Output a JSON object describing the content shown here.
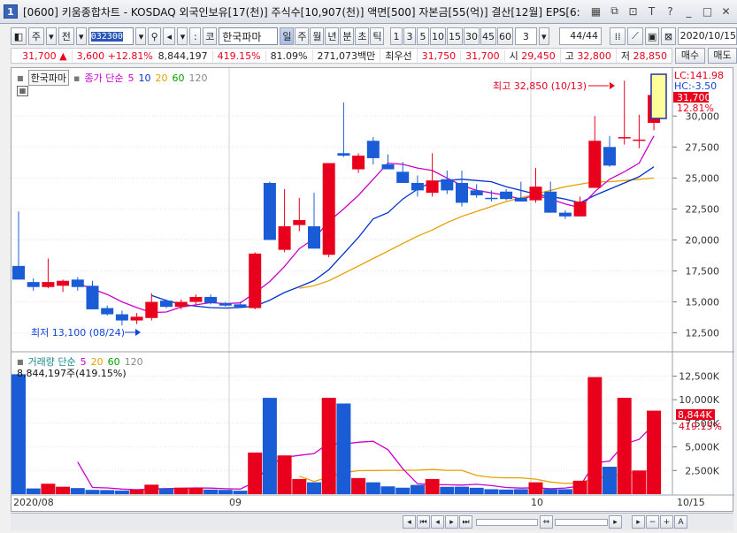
{
  "window": {
    "number": "1",
    "title": "[0600] 키움종합차트 - KOSDAQ 외국인보유[17(천)] 주식수[10,907(천)] 액면[500] 자본금[55(억)] 결산[12월] EPS[6:"
  },
  "toolbar": {
    "period_main": "주",
    "period_all": "전",
    "stock_code": "032300",
    "stock_prefix": "코",
    "stock_name": "한국파마",
    "period_tabs": [
      "일",
      "주",
      "월",
      "년",
      "분",
      "초",
      "틱"
    ],
    "selected_period": "일",
    "interval_buttons": [
      "1",
      "3",
      "5",
      "10",
      "15",
      "30",
      "45",
      "60"
    ],
    "interval_select": "3",
    "page_count": "44/44",
    "date": "2020/10/15"
  },
  "quote": {
    "price": "31,700",
    "direction": "▲",
    "change": "3,600",
    "change_pct": "+12.81%",
    "volume": "8,844,197",
    "volume_ratio": "419.15%",
    "rate": "81.09%",
    "amount": "271,073백만",
    "pref_label": "최우선",
    "ask": "31,750",
    "bid": "31,700",
    "open_label": "시",
    "open": "29,450",
    "high_label": "고",
    "high": "32,800",
    "low_label": "저",
    "low": "28,850",
    "buy_label": "매수",
    "sell_label": "매도"
  },
  "chart_legend": {
    "name": "한국파마",
    "price_label": "종가 단순",
    "ma": [
      "5",
      "10",
      "20",
      "60",
      "120"
    ],
    "ma_colors": [
      "#cc00cc",
      "#0033cc",
      "#e8a000",
      "#00a000",
      "#888888"
    ],
    "lc": "LC:141.98",
    "hc": "HC:-3.50",
    "last_price": "31,700",
    "last_pct": "12.81%"
  },
  "annotations": {
    "high": "최고 32,850 (10/13)",
    "low": "최저 13,100 (08/24)"
  },
  "volume_legend": {
    "label": "거래량 단순",
    "ma": [
      "5",
      "20",
      "60",
      "120"
    ],
    "value": "8,844,197주(419.15%)",
    "last": "8,844K",
    "last_pct": "419.15%"
  },
  "x_labels": [
    "2020/08",
    "09",
    "10",
    "10/15"
  ],
  "chart_data": {
    "type": "candlestick",
    "price_ticks": [
      "12,500",
      "15,000",
      "17,500",
      "20,000",
      "22,500",
      "25,000",
      "27,500",
      "30,000"
    ],
    "volume_ticks": [
      "2,500K",
      "5,000K",
      "7,500K",
      "10,000K",
      "12,500K"
    ],
    "candles": [
      {
        "o": 17900,
        "h": 22300,
        "l": 16800,
        "c": 16800
      },
      {
        "o": 16600,
        "h": 16900,
        "l": 15900,
        "c": 16200
      },
      {
        "o": 16200,
        "h": 18500,
        "l": 16100,
        "c": 16600
      },
      {
        "o": 16300,
        "h": 16800,
        "l": 15800,
        "c": 16700
      },
      {
        "o": 16800,
        "h": 17000,
        "l": 15900,
        "c": 16200
      },
      {
        "o": 16300,
        "h": 16700,
        "l": 14400,
        "c": 14400
      },
      {
        "o": 14500,
        "h": 14700,
        "l": 13900,
        "c": 14000
      },
      {
        "o": 14000,
        "h": 14300,
        "l": 13100,
        "c": 13500
      },
      {
        "o": 13500,
        "h": 14100,
        "l": 13200,
        "c": 13800
      },
      {
        "o": 13700,
        "h": 15700,
        "l": 13500,
        "c": 15000
      },
      {
        "o": 15100,
        "h": 15200,
        "l": 14500,
        "c": 14600
      },
      {
        "o": 14600,
        "h": 15200,
        "l": 14400,
        "c": 15000
      },
      {
        "o": 15000,
        "h": 15600,
        "l": 14800,
        "c": 15400
      },
      {
        "o": 15400,
        "h": 15600,
        "l": 14800,
        "c": 14900
      },
      {
        "o": 14900,
        "h": 15000,
        "l": 14600,
        "c": 14700
      },
      {
        "o": 14800,
        "h": 15000,
        "l": 14500,
        "c": 14600
      },
      {
        "o": 14500,
        "h": 19000,
        "l": 14400,
        "c": 18900
      },
      {
        "o": 24600,
        "h": 24700,
        "l": 20000,
        "c": 20000
      },
      {
        "o": 19200,
        "h": 24100,
        "l": 19000,
        "c": 21100
      },
      {
        "o": 21200,
        "h": 23400,
        "l": 20700,
        "c": 21600
      },
      {
        "o": 21100,
        "h": 23800,
        "l": 19300,
        "c": 19300
      },
      {
        "o": 18800,
        "h": 26200,
        "l": 18600,
        "c": 26200
      },
      {
        "o": 27000,
        "h": 31100,
        "l": 26700,
        "c": 26800
      },
      {
        "o": 25700,
        "h": 27000,
        "l": 25400,
        "c": 26800
      },
      {
        "o": 28000,
        "h": 28300,
        "l": 26100,
        "c": 26600
      },
      {
        "o": 26100,
        "h": 26900,
        "l": 25900,
        "c": 25700
      },
      {
        "o": 25500,
        "h": 26300,
        "l": 24600,
        "c": 24600
      },
      {
        "o": 24600,
        "h": 25200,
        "l": 23500,
        "c": 24000
      },
      {
        "o": 23800,
        "h": 27000,
        "l": 23500,
        "c": 24800
      },
      {
        "o": 24900,
        "h": 25600,
        "l": 23700,
        "c": 24000
      },
      {
        "o": 24600,
        "h": 25600,
        "l": 22700,
        "c": 23000
      },
      {
        "o": 24000,
        "h": 24500,
        "l": 23400,
        "c": 23600
      },
      {
        "o": 23400,
        "h": 24000,
        "l": 23100,
        "c": 23300
      },
      {
        "o": 23900,
        "h": 24100,
        "l": 23200,
        "c": 23300
      },
      {
        "o": 23400,
        "h": 24700,
        "l": 23200,
        "c": 23100
      },
      {
        "o": 23200,
        "h": 25800,
        "l": 23000,
        "c": 24300
      },
      {
        "o": 23900,
        "h": 24700,
        "l": 22200,
        "c": 22200
      },
      {
        "o": 22200,
        "h": 22400,
        "l": 21700,
        "c": 21900
      },
      {
        "o": 21900,
        "h": 23500,
        "l": 21900,
        "c": 23100
      },
      {
        "o": 24200,
        "h": 30000,
        "l": 24200,
        "c": 28000
      },
      {
        "o": 27500,
        "h": 28400,
        "l": 25900,
        "c": 26000
      },
      {
        "o": 28200,
        "h": 32850,
        "l": 27700,
        "c": 28300
      },
      {
        "o": 28100,
        "h": 30100,
        "l": 27400,
        "c": 28100
      },
      {
        "o": 29450,
        "h": 32800,
        "l": 28850,
        "c": 31700
      }
    ],
    "volume": [
      12700,
      600,
      1100,
      780,
      640,
      450,
      430,
      370,
      470,
      1000,
      600,
      680,
      660,
      480,
      450,
      360,
      4400,
      10200,
      4100,
      1600,
      1250,
      10200,
      9600,
      1700,
      1250,
      820,
      680,
      970,
      1600,
      770,
      780,
      670,
      520,
      480,
      520,
      1250,
      540,
      520,
      1420,
      12400,
      2900,
      10200,
      2500,
      8844
    ],
    "ma5_price": [
      null,
      null,
      null,
      null,
      16500,
      16040,
      15600,
      15000,
      14540,
      14140,
      14180,
      14580,
      14760,
      14940,
      14860,
      14920,
      15730,
      16640,
      17860,
      19300,
      20100,
      21500,
      22500,
      23600,
      24900,
      26200,
      26100,
      25800,
      25600,
      25000,
      24400,
      24000,
      23800,
      23600,
      23300,
      23600,
      23300,
      22900,
      22600,
      23900,
      24900,
      25500,
      26200,
      28400
    ],
    "ma10_price": [
      null,
      null,
      null,
      null,
      null,
      null,
      null,
      null,
      null,
      15520,
      15110,
      14810,
      14650,
      14540,
      14500,
      14550,
      14650,
      15140,
      15760,
      16220,
      16720,
      17600,
      18900,
      20200,
      21700,
      22200,
      23300,
      24100,
      24700,
      24800,
      24900,
      24800,
      24700,
      24300,
      24000,
      23700,
      23500,
      23300,
      23000,
      23600,
      24100,
      24600,
      25100,
      25900
    ],
    "ma20_price": [
      null,
      null,
      null,
      null,
      null,
      null,
      null,
      null,
      null,
      null,
      null,
      null,
      null,
      null,
      null,
      null,
      null,
      null,
      null,
      16100,
      16300,
      16700,
      17300,
      17900,
      18500,
      19100,
      19700,
      20300,
      20800,
      21400,
      21900,
      22300,
      22700,
      23100,
      23400,
      23700,
      24000,
      24300,
      24500,
      24700,
      24700,
      24800,
      24900,
      25000
    ],
    "ma5_volume": [
      null,
      null,
      null,
      null,
      3400,
      700,
      660,
      530,
      470,
      540,
      580,
      620,
      660,
      640,
      570,
      530,
      1270,
      3100,
      3900,
      4100,
      4300,
      5400,
      5300,
      5500,
      5600,
      4700,
      2700,
      1100,
      1000,
      990,
      960,
      1040,
      900,
      700,
      640,
      670,
      570,
      650,
      850,
      3300,
      3500,
      5300,
      5800,
      7400
    ],
    "ma20_volume": [
      null,
      null,
      null,
      null,
      null,
      null,
      null,
      null,
      null,
      null,
      null,
      null,
      null,
      null,
      null,
      null,
      null,
      null,
      null,
      1900,
      1340,
      1820,
      2280,
      2480,
      2500,
      2520,
      2520,
      2540,
      2600,
      2520,
      2520,
      1980,
      1780,
      1720,
      1720,
      1580,
      1280,
      1130,
      1180,
      1750,
      1800,
      2250,
      2280,
      2600
    ]
  }
}
